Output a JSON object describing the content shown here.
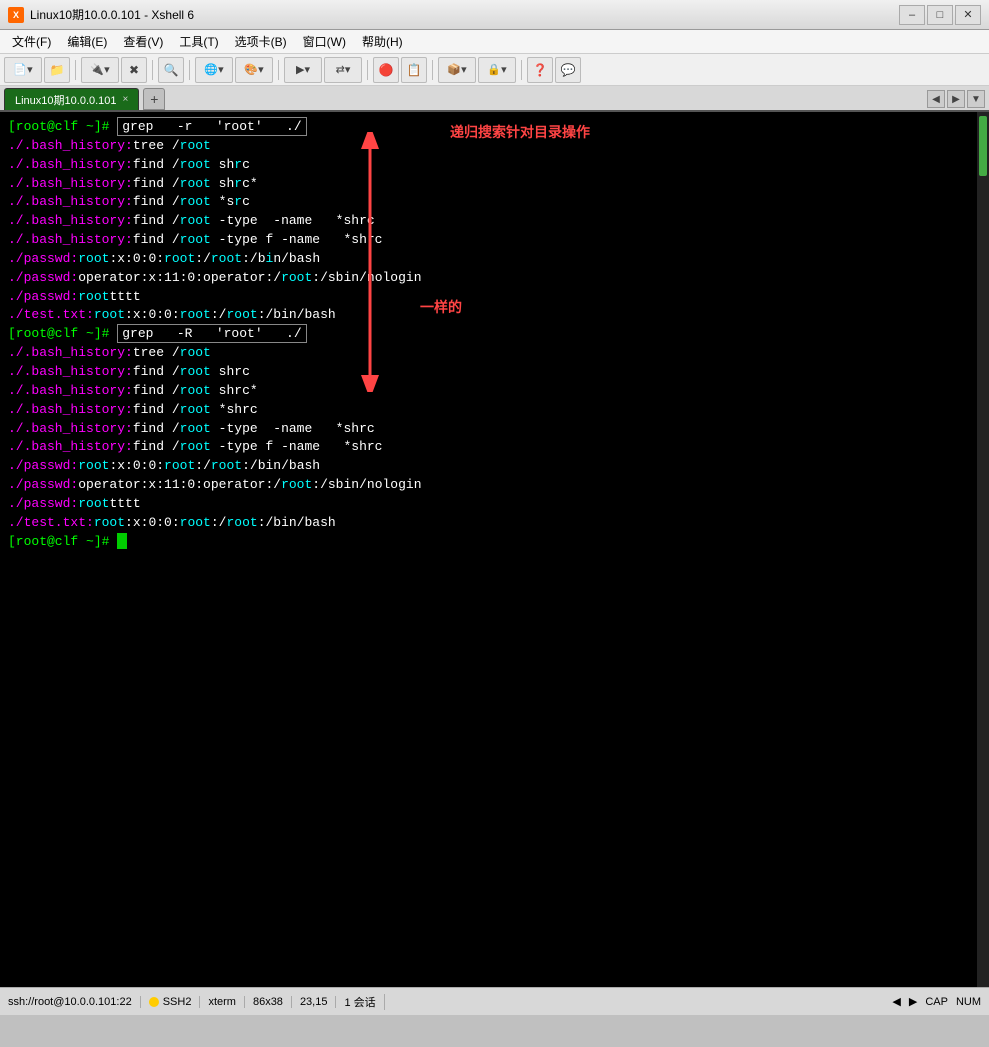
{
  "window": {
    "title": "Linux10期10.0.0.101 - Xshell 6",
    "icon": "X"
  },
  "menu": {
    "items": [
      "文件(F)",
      "编辑(E)",
      "查看(V)",
      "工具(T)",
      "选项卡(B)",
      "窗口(W)",
      "帮助(H)"
    ]
  },
  "tab": {
    "label": "Linux10期10.0.0.101",
    "close": "×"
  },
  "terminal": {
    "lines": [
      {
        "type": "prompt_cmd",
        "prompt": "[root@clf ~]# ",
        "cmd_box": "grep   -r   'root'   ./"
      },
      {
        "type": "output_multi",
        "parts": [
          {
            "color": "magenta",
            "text": "./.bash_history:"
          },
          {
            "color": "white",
            "text": "tree /"
          },
          {
            "color": "cyan",
            "text": "root"
          }
        ]
      },
      {
        "type": "output_multi",
        "parts": [
          {
            "color": "magenta",
            "text": "./.bash_history:"
          },
          {
            "color": "white",
            "text": "find /"
          },
          {
            "color": "cyan",
            "text": "root"
          },
          {
            "color": "white",
            "text": " sh"
          },
          {
            "color": "cyan",
            "text": "r"
          },
          {
            "color": "white",
            "text": "c"
          }
        ]
      },
      {
        "type": "output_multi",
        "parts": [
          {
            "color": "magenta",
            "text": "./.bash_history:"
          },
          {
            "color": "white",
            "text": "find /"
          },
          {
            "color": "cyan",
            "text": "root"
          },
          {
            "color": "white",
            "text": " sh"
          },
          {
            "color": "cyan",
            "text": "r"
          },
          {
            "color": "white",
            "text": "c*"
          }
        ]
      },
      {
        "type": "output_multi",
        "parts": [
          {
            "color": "magenta",
            "text": "./.bash_history:"
          },
          {
            "color": "white",
            "text": "find /"
          },
          {
            "color": "cyan",
            "text": "root"
          },
          {
            "color": "white",
            "text": " *s"
          },
          {
            "color": "cyan",
            "text": "r"
          },
          {
            "color": "white",
            "text": "c"
          }
        ]
      },
      {
        "type": "output_multi",
        "parts": [
          {
            "color": "magenta",
            "text": "./.bash_history:"
          },
          {
            "color": "white",
            "text": "find /"
          },
          {
            "color": "cyan",
            "text": "root"
          },
          {
            "color": "white",
            "text": " -type  -name   *shrc"
          }
        ]
      },
      {
        "type": "output_multi",
        "parts": [
          {
            "color": "magenta",
            "text": "./.bash_history:"
          },
          {
            "color": "white",
            "text": "find /"
          },
          {
            "color": "cyan",
            "text": "root"
          },
          {
            "color": "white",
            "text": " -type f -name   *shrc"
          }
        ]
      },
      {
        "type": "output_multi",
        "parts": [
          {
            "color": "magenta",
            "text": "./passwd:"
          },
          {
            "color": "cyan",
            "text": "root"
          },
          {
            "color": "white",
            "text": ":x:0:0:"
          },
          {
            "color": "cyan",
            "text": "root"
          },
          {
            "color": "white",
            "text": ":/"
          },
          {
            "color": "cyan",
            "text": "root"
          },
          {
            "color": "white",
            "text": ":/b"
          },
          {
            "color": "cyan",
            "text": "i"
          },
          {
            "color": "white",
            "text": "n/bash"
          }
        ]
      },
      {
        "type": "output_multi",
        "parts": [
          {
            "color": "magenta",
            "text": "./passwd:"
          },
          {
            "color": "white",
            "text": "operator:x:11:0:operator:/"
          },
          {
            "color": "cyan",
            "text": "root"
          },
          {
            "color": "white",
            "text": ":/sbin/nologin"
          }
        ]
      },
      {
        "type": "output_multi",
        "parts": [
          {
            "color": "magenta",
            "text": "./passwd:"
          },
          {
            "color": "cyan",
            "text": "root"
          },
          {
            "color": "white",
            "text": "tttt"
          }
        ]
      },
      {
        "type": "output_multi",
        "parts": [
          {
            "color": "magenta",
            "text": "./test.txt:"
          },
          {
            "color": "cyan",
            "text": "root"
          },
          {
            "color": "white",
            "text": ":x:0:0:"
          },
          {
            "color": "cyan",
            "text": "root"
          },
          {
            "color": "white",
            "text": ":/"
          },
          {
            "color": "cyan",
            "text": "root"
          },
          {
            "color": "white",
            "text": ":/bin/bash"
          }
        ]
      },
      {
        "type": "prompt_cmd",
        "prompt": "[root@clf ~]# ",
        "cmd_box": "grep   -R   'root'   ./"
      },
      {
        "type": "output_multi",
        "parts": [
          {
            "color": "magenta",
            "text": "./.bash_history:"
          },
          {
            "color": "white",
            "text": "tree /"
          },
          {
            "color": "cyan",
            "text": "root"
          }
        ]
      },
      {
        "type": "output_multi",
        "parts": [
          {
            "color": "magenta",
            "text": "./.bash_history:"
          },
          {
            "color": "white",
            "text": "find /"
          },
          {
            "color": "cyan",
            "text": "root"
          },
          {
            "color": "white",
            "text": " shrc"
          }
        ]
      },
      {
        "type": "output_multi",
        "parts": [
          {
            "color": "magenta",
            "text": "./.bash_history:"
          },
          {
            "color": "white",
            "text": "find /"
          },
          {
            "color": "cyan",
            "text": "root"
          },
          {
            "color": "white",
            "text": " shrc*"
          }
        ]
      },
      {
        "type": "output_multi",
        "parts": [
          {
            "color": "magenta",
            "text": "./.bash_history:"
          },
          {
            "color": "white",
            "text": "find /"
          },
          {
            "color": "cyan",
            "text": "root"
          },
          {
            "color": "white",
            "text": " *shrc"
          }
        ]
      },
      {
        "type": "output_multi",
        "parts": [
          {
            "color": "magenta",
            "text": "./.bash_history:"
          },
          {
            "color": "white",
            "text": "find /"
          },
          {
            "color": "cyan",
            "text": "root"
          },
          {
            "color": "white",
            "text": " -type  -name   *shrc"
          }
        ]
      },
      {
        "type": "output_multi",
        "parts": [
          {
            "color": "magenta",
            "text": "./.bash_history:"
          },
          {
            "color": "white",
            "text": "find /"
          },
          {
            "color": "cyan",
            "text": "root"
          },
          {
            "color": "white",
            "text": " -type f -name   *shrc"
          }
        ]
      },
      {
        "type": "output_multi",
        "parts": [
          {
            "color": "magenta",
            "text": "./passwd:"
          },
          {
            "color": "cyan",
            "text": "root"
          },
          {
            "color": "white",
            "text": ":x:0:0:"
          },
          {
            "color": "cyan",
            "text": "root"
          },
          {
            "color": "white",
            "text": ":/"
          },
          {
            "color": "cyan",
            "text": "root"
          },
          {
            "color": "white",
            "text": ":/bin/bash"
          }
        ]
      },
      {
        "type": "output_multi",
        "parts": [
          {
            "color": "magenta",
            "text": "./passwd:"
          },
          {
            "color": "white",
            "text": "operator:x:11:0:operator:/"
          },
          {
            "color": "cyan",
            "text": "root"
          },
          {
            "color": "white",
            "text": ":/sbin/nologin"
          }
        ]
      },
      {
        "type": "output_multi",
        "parts": [
          {
            "color": "magenta",
            "text": "./passwd:"
          },
          {
            "color": "cyan",
            "text": "root"
          },
          {
            "color": "white",
            "text": "tttt"
          }
        ]
      },
      {
        "type": "output_multi",
        "parts": [
          {
            "color": "magenta",
            "text": "./test.txt:"
          },
          {
            "color": "cyan",
            "text": "root"
          },
          {
            "color": "white",
            "text": ":x:0:0:"
          },
          {
            "color": "cyan",
            "text": "root"
          },
          {
            "color": "white",
            "text": ":/"
          },
          {
            "color": "cyan",
            "text": "root"
          },
          {
            "color": "white",
            "text": ":/bin/bash"
          }
        ]
      },
      {
        "type": "prompt_cursor",
        "prompt": "[root@clf ~]# "
      }
    ],
    "annotation1_text": "递归搜索针对目录操作",
    "annotation2_text": "一样的"
  },
  "status_bar": {
    "connection": "ssh://root@10.0.0.101:22",
    "protocol": "SSH2",
    "term": "xterm",
    "cols": "86x38",
    "pos": "23,15",
    "sessions": "1 会话",
    "caps": "CAP",
    "num": "NUM"
  }
}
